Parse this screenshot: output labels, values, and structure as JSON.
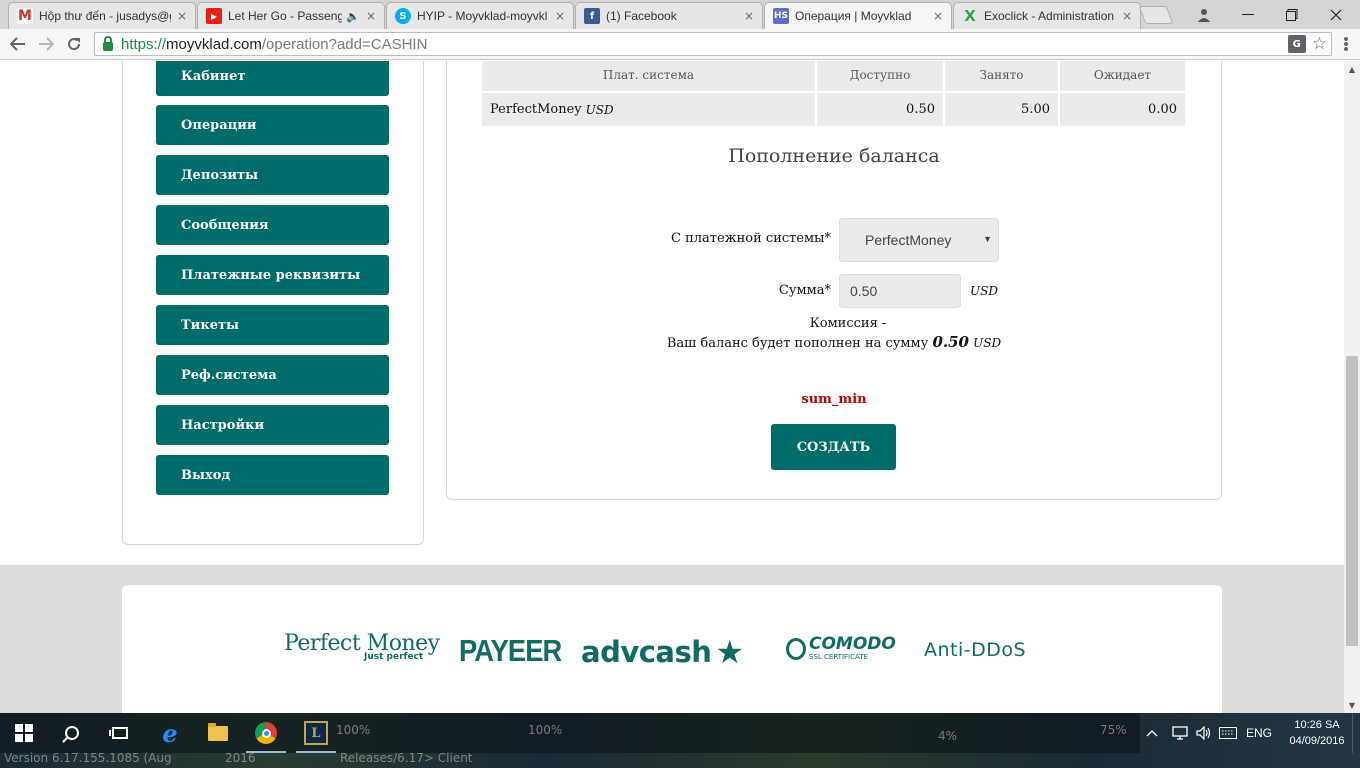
{
  "browser": {
    "tabs": [
      {
        "label": "Hộp thư đến - jusadys@g",
        "icon": "gmail-icon",
        "color": "#d93025"
      },
      {
        "label": "Let Her Go - Passenge",
        "icon": "youtube-icon",
        "color": "#e62117",
        "sound": "🔈"
      },
      {
        "label": "HYIP - Moyvklad-moyvkl",
        "icon": "skype-icon",
        "color": "#00aff0"
      },
      {
        "label": "(1) Facebook",
        "icon": "facebook-icon",
        "color": "#3b5998"
      },
      {
        "label": "Операция | Moyvklad",
        "icon": "moyvklad-icon",
        "color": "#5b6fc9"
      },
      {
        "label": "Exoclick - Administration",
        "icon": "exoclick-icon",
        "color": "#2aa84a"
      }
    ],
    "close_glyph": "×",
    "url": {
      "scheme": "https://",
      "host": "moyvklad.com",
      "path": "/operation?add=CASHIN"
    }
  },
  "sidebar": {
    "items": [
      "Кабинет",
      "Операции",
      "Депозиты",
      "Сообщения",
      "Платежные реквизиты",
      "Тикеты",
      "Реф.система",
      "Настройки",
      "Выход"
    ]
  },
  "balance_table": {
    "headers": [
      "Плат. система",
      "Доступно",
      "Занято",
      "Ожидает"
    ],
    "rows": [
      {
        "system": "PerfectMoney",
        "currency": "USD",
        "available": "0.50",
        "busy": "5.00",
        "pending": "0.00"
      }
    ]
  },
  "form": {
    "title": "Пополнение баланса",
    "system_label": "С платежной системы*",
    "system_value": "PerfectMoney",
    "sum_label": "Сумма*",
    "sum_value": "0.50",
    "sum_unit": "USD",
    "commission_text": "Комиссия -",
    "result_text": "Ваш баланс будет пополнен на сумму",
    "result_amount": "0.50",
    "result_unit": "USD",
    "error": "sum_min",
    "submit_label": "СОЗДАТЬ"
  },
  "footer": {
    "logos": {
      "perfect_money": "Perfect Money",
      "perfect_money_tagline": "Just perfect",
      "payeer": "PAYEER",
      "advcash": "advcash",
      "advcash_mark": "★",
      "comodo": "COMODO",
      "comodo_sub": "SSL CERTIFICATE",
      "antiddos": "Anti-DDoS"
    }
  },
  "taskbar": {
    "game_texts": [
      "Version 6.17.155.1085 (Aug",
      "2016",
      "Releases/6.17> Client",
      "100%",
      "100%",
      "4%",
      "75%"
    ],
    "language": "ENG",
    "time": "10:26 SA",
    "date": "04/09/2016"
  }
}
